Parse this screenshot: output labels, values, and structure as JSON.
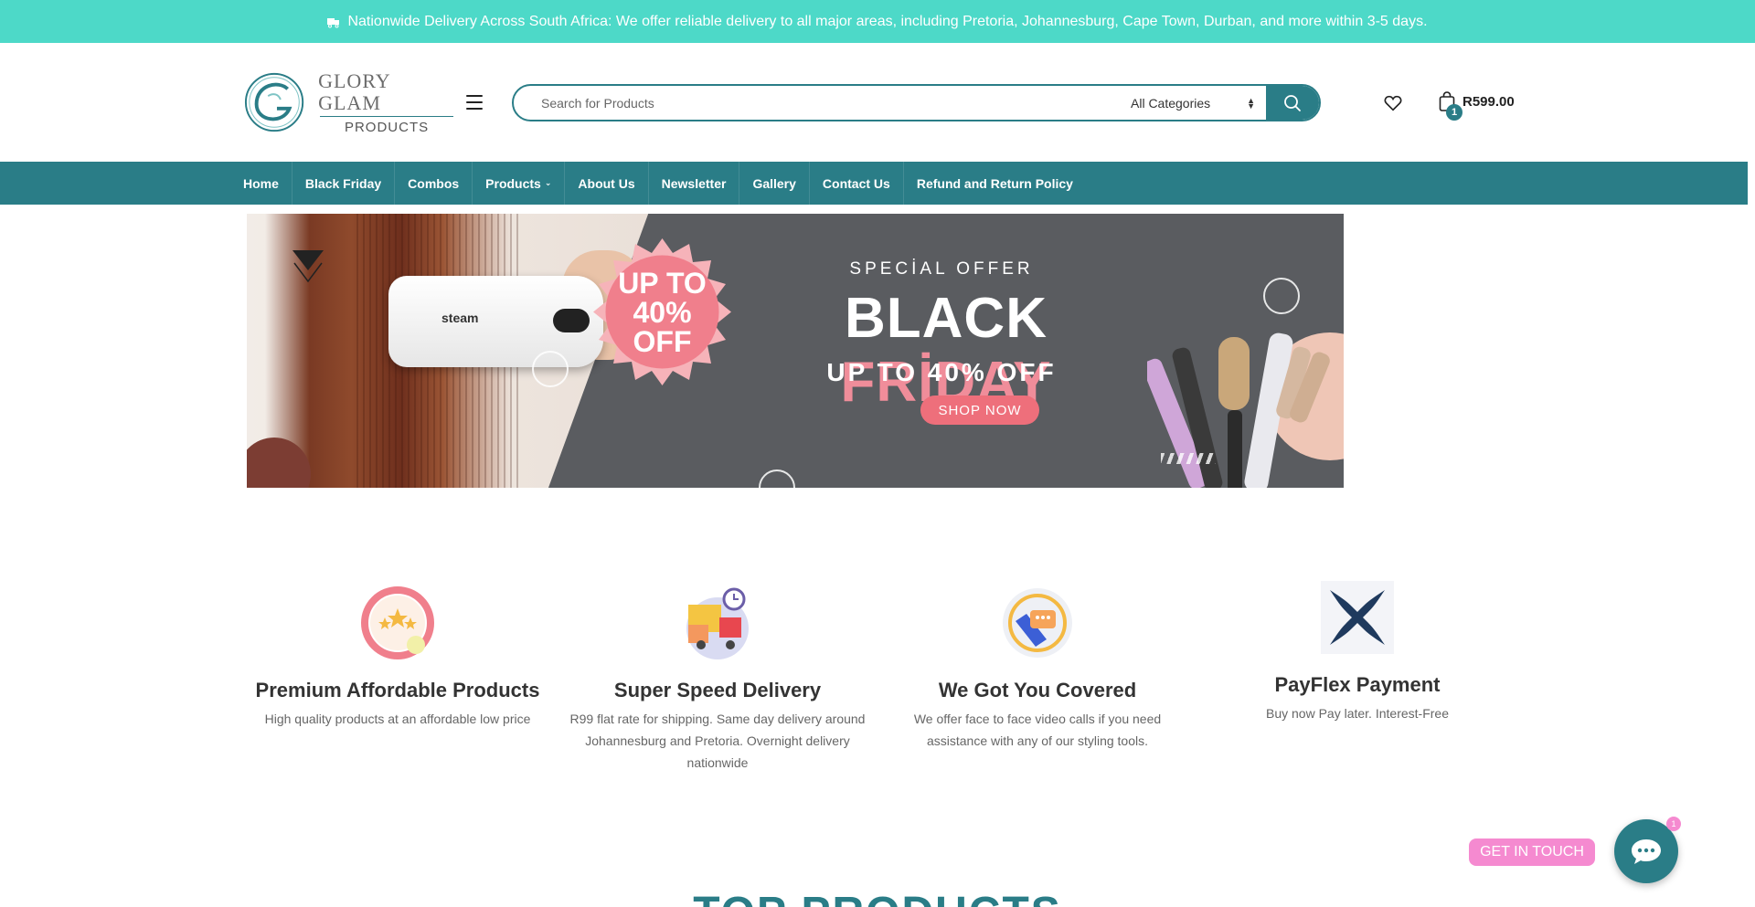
{
  "announcement": {
    "text": "Nationwide Delivery Across South Africa: We offer reliable delivery to all major areas, including Pretoria, Johannesburg, Cape Town, Durban, and more within 3-5 days.",
    "icon": "truck-icon"
  },
  "header": {
    "logo": {
      "name": "GLORY GLAM",
      "sub": "PRODUCTS"
    },
    "search": {
      "placeholder": "Search for Products",
      "category": "All Categories"
    },
    "cart": {
      "count": "1",
      "total": "R599.00"
    }
  },
  "nav": {
    "items": [
      {
        "label": "Home"
      },
      {
        "label": "Black Friday"
      },
      {
        "label": "Combos"
      },
      {
        "label": "Products"
      },
      {
        "label": "About Us"
      },
      {
        "label": "Newsletter"
      },
      {
        "label": "Gallery"
      },
      {
        "label": "Contact Us"
      },
      {
        "label": "Refund and Return Policy"
      }
    ]
  },
  "hero": {
    "badge": {
      "line1": "UP TO",
      "line2": "40%",
      "line3": "OFF"
    },
    "special": "SPECİAL OFFER",
    "title_white": "BLACK ",
    "title_pink": "FRİDAY",
    "subtitle": "UP TO 40% OFF",
    "cta": "SHOP NOW",
    "device_brand": "steam"
  },
  "features": [
    {
      "title": "Premium Affordable Products",
      "text": "High quality products at an affordable low price",
      "icon": "stars-badge-icon"
    },
    {
      "title": "Super Speed Delivery",
      "text": "R99 flat rate for shipping. Same day delivery around Johannesburg and Pretoria. Overnight delivery nationwide",
      "icon": "delivery-truck-icon"
    },
    {
      "title": "We Got You Covered",
      "text": "We offer face to face video calls if you need assistance with any of our styling tools.",
      "icon": "video-call-icon"
    },
    {
      "title": "PayFlex Payment",
      "text": "Buy now Pay later. Interest-Free",
      "icon": "payflex-logo-icon"
    }
  ],
  "section": {
    "title": "TOP PRODUCTS"
  },
  "contact_widget": {
    "label": "GET IN TOUCH",
    "badge": "1"
  },
  "colors": {
    "teal": "#2a7d87",
    "aqua": "#4dd9c8",
    "pink": "#f08d9a",
    "widget_pink": "#f58ad0"
  }
}
